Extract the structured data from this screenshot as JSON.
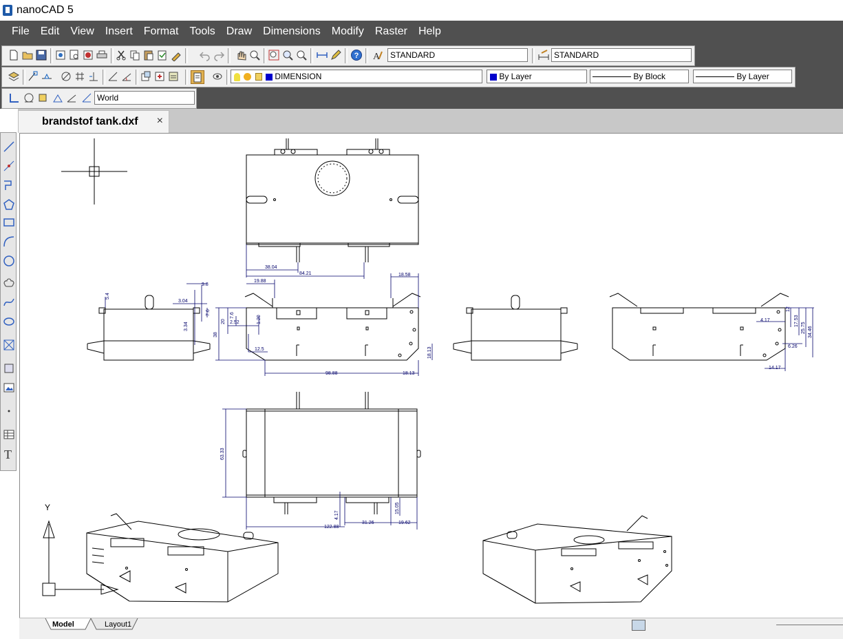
{
  "window": {
    "title": "nanoCAD 5"
  },
  "menu": [
    "File",
    "Edit",
    "View",
    "Insert",
    "Format",
    "Tools",
    "Draw",
    "Dimensions",
    "Modify",
    "Raster",
    "Help"
  ],
  "toolbar": {
    "text_style": "STANDARD",
    "dim_style": "STANDARD",
    "layer": "DIMENSION",
    "color": "By Layer",
    "linetype": "By Block",
    "lineweight": "By Layer",
    "ucs": "World"
  },
  "document_tab": {
    "label": "brandstof tank.dxf",
    "close": "×"
  },
  "layout_tabs": [
    "Model",
    "Layout1"
  ],
  "ucs_icon": {
    "y_label": "Y"
  },
  "dimensions": {
    "top": [
      "38.04",
      "84.21"
    ],
    "side_header": [
      "19.88",
      "18.58",
      "9.8",
      "5.4",
      "3.04",
      "7.6"
    ],
    "front_left": [
      "3.34",
      "20",
      "7.6",
      "2.52",
      "1.20",
      "38",
      "12.5"
    ],
    "front_bottom": [
      "98.88",
      "18.13",
      "18.13"
    ],
    "right_view": [
      "4.17",
      "17.53",
      "25.75",
      "34.46",
      "6.26",
      "14.17",
      "12"
    ],
    "plan": [
      "63.33",
      "4.17",
      "122.88",
      "31.26",
      "15.05",
      "19.62"
    ]
  },
  "colors": {
    "chrome": "#505050",
    "dimension": "#00006a",
    "layer_swatch": "#0000cc"
  }
}
